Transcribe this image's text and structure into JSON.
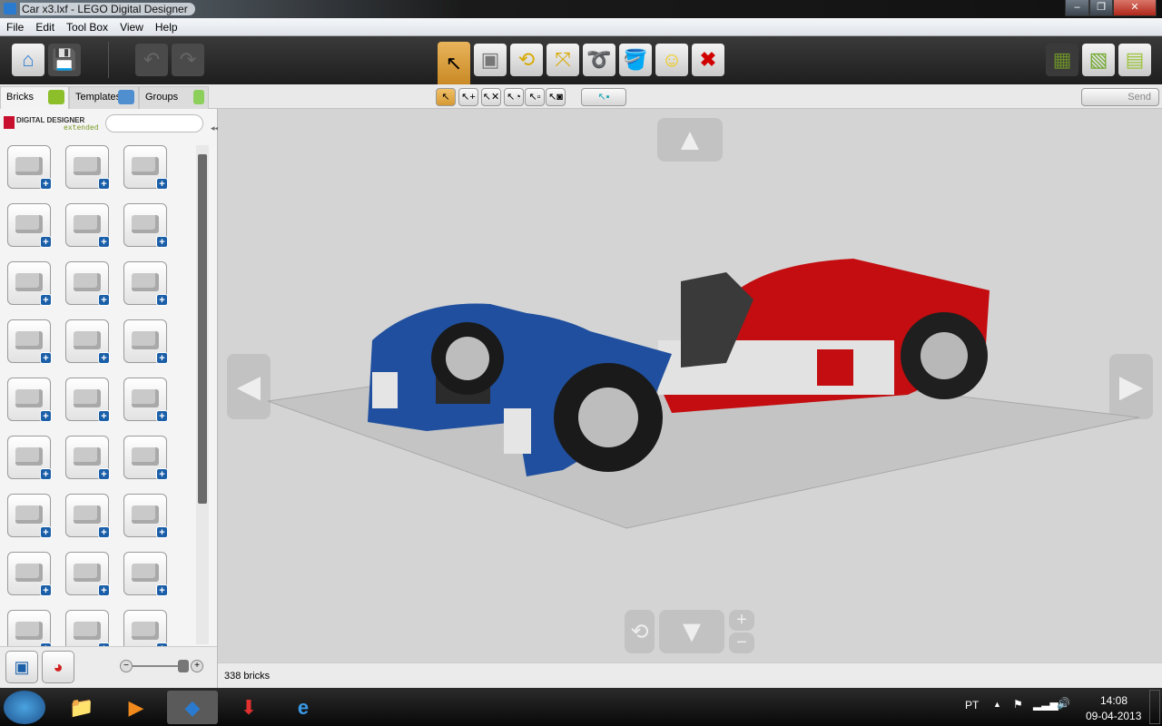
{
  "window": {
    "title": "Car x3.lxf - LEGO Digital Designer",
    "minimize": "–",
    "maximize": "❐",
    "close": "✕"
  },
  "menu": [
    "File",
    "Edit",
    "Tool Box",
    "View",
    "Help"
  ],
  "left_tabs": [
    {
      "label": "Bricks"
    },
    {
      "label": "Templates"
    },
    {
      "label": "Groups"
    }
  ],
  "brand": {
    "name": "DIGITAL DESIGNER",
    "edition": "extended"
  },
  "search": {
    "placeholder": "",
    "value": ""
  },
  "send_label": "Send",
  "status": {
    "brick_count": "338 bricks"
  },
  "zoom_slider": {
    "value": 0.85
  },
  "clock": {
    "time": "14:08",
    "date": "09-04-2013"
  },
  "tray": {
    "language": "PT"
  },
  "colors": {
    "accent": "#d69a34",
    "brand": "#c8102e",
    "car_blue": "#1f4f9e",
    "car_red": "#c40d10"
  }
}
